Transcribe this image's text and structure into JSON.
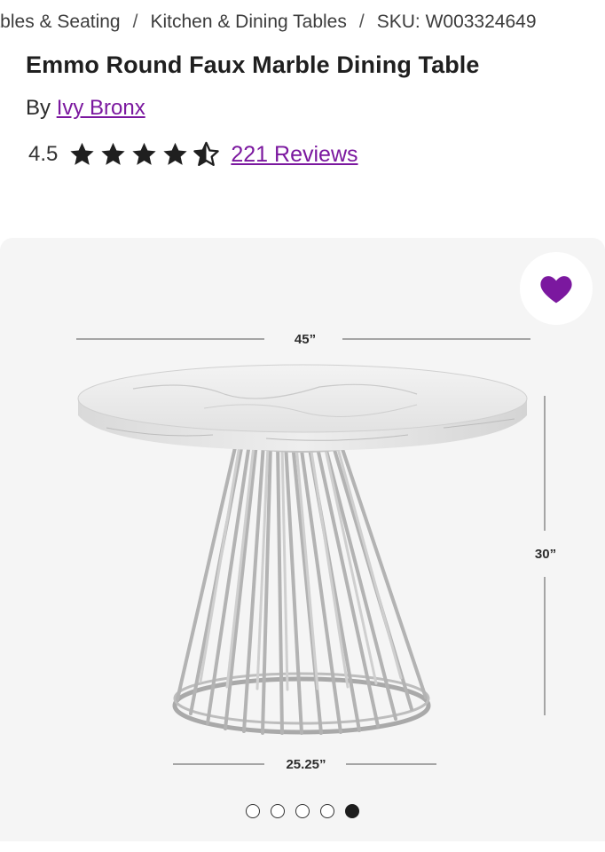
{
  "breadcrumb": {
    "items": [
      "Tables & Seating",
      "Kitchen & Dining Tables"
    ],
    "separator": "/",
    "sku": "SKU: W003324649"
  },
  "product": {
    "title": "Emmo Round Faux Marble Dining Table",
    "by_prefix": "By",
    "brand": "Ivy Bronx",
    "rating": {
      "value": "4.5",
      "stars_filled": 4.5,
      "stars_total": 5,
      "reviews_label": "221 Reviews"
    }
  },
  "gallery": {
    "favorite_icon": "heart-icon",
    "favorite_color": "#7b189f",
    "dimensions": {
      "width": "45”",
      "height": "30”",
      "base": "25.25”"
    },
    "slide_count": 5,
    "active_slide": 5
  },
  "colors": {
    "accent": "#7b189f",
    "text": "#2b2b2b",
    "gallery_bg": "#f5f5f5"
  }
}
